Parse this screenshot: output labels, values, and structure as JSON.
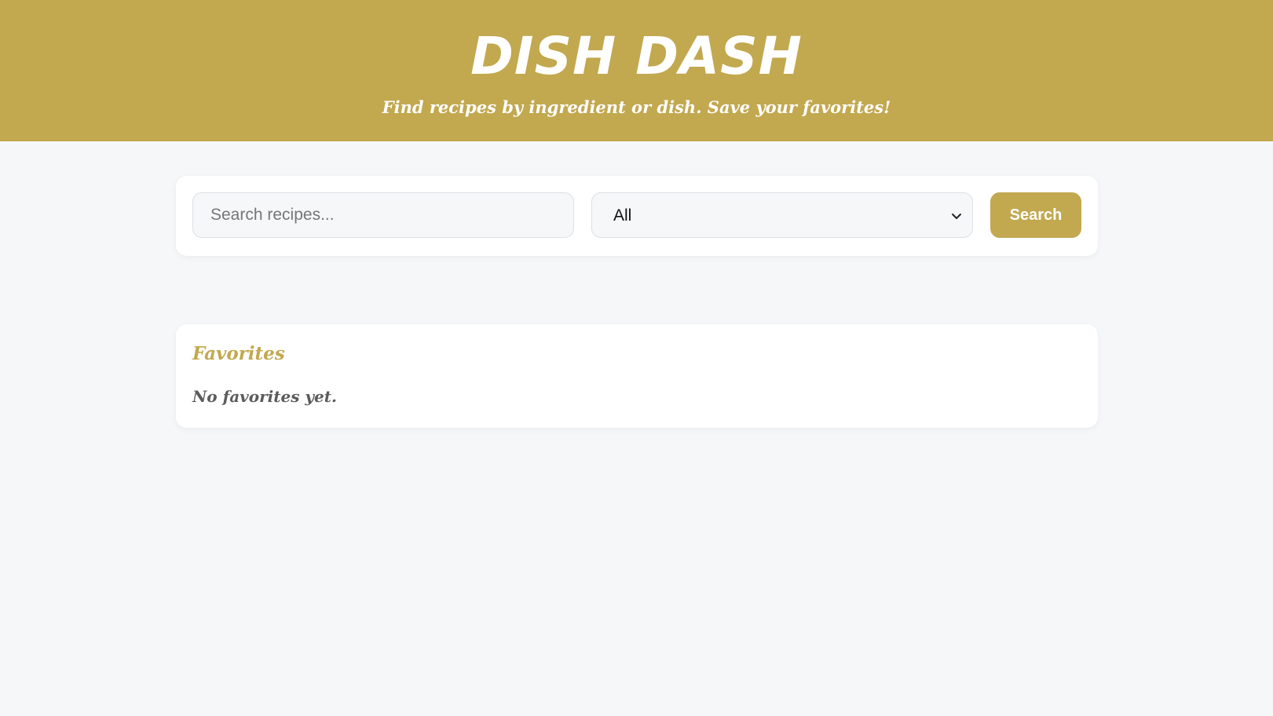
{
  "header": {
    "title": "DISH DASH",
    "subtitle": "Find recipes by ingredient or dish. Save your favorites!"
  },
  "search": {
    "placeholder": "Search recipes...",
    "value": "",
    "category_selected": "All",
    "button_label": "Search"
  },
  "favorites": {
    "title": "Favorites",
    "empty_message": "No favorites yet."
  },
  "colors": {
    "brand": "#c2a84f",
    "page_background": "#f6f7f9",
    "card_background": "#ffffff"
  },
  "icons": {
    "select_arrow": "chevron-down-icon"
  }
}
